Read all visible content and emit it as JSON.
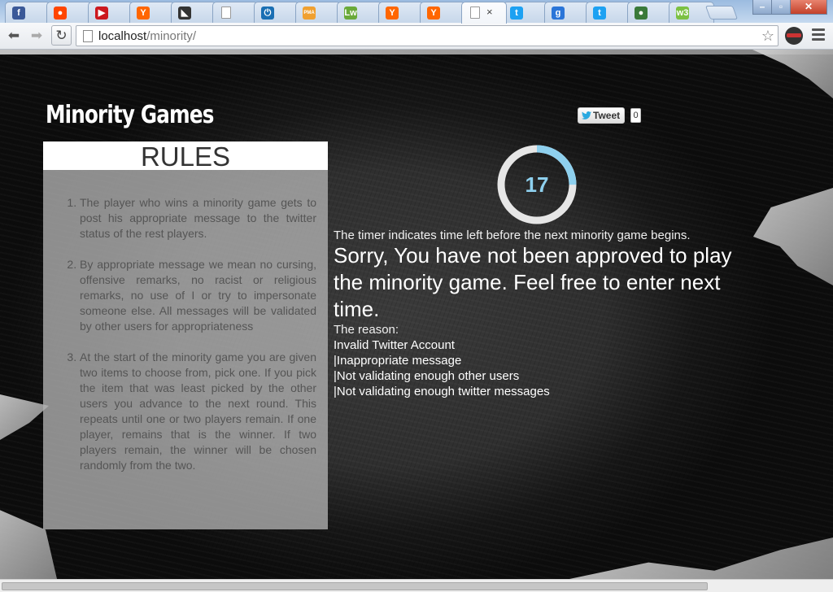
{
  "browser": {
    "tabs": [
      {
        "icon": "facebook-icon",
        "glyph": "f",
        "color": "#3b5998"
      },
      {
        "icon": "reddit-icon",
        "glyph": "●",
        "color": "#ff4500"
      },
      {
        "icon": "youtube-icon",
        "glyph": "▶",
        "color": "#cc181e"
      },
      {
        "icon": "hacker-news-icon",
        "glyph": "Y",
        "color": "#ff6600"
      },
      {
        "icon": "app-icon",
        "glyph": "◣",
        "color": "#333333"
      },
      {
        "icon": "blank-page-icon",
        "glyph": "",
        "color": "#ffffff"
      },
      {
        "icon": "power-icon",
        "glyph": "⏻",
        "color": "#1a6fb3"
      },
      {
        "icon": "phpmyadmin-icon",
        "glyph": "PMA",
        "color": "#f0a030"
      },
      {
        "icon": "lw-icon",
        "glyph": "Lw",
        "color": "#6aaa3a"
      },
      {
        "icon": "hacker-news-icon",
        "glyph": "Y",
        "color": "#ff6600"
      },
      {
        "icon": "hacker-news-icon",
        "glyph": "Y",
        "color": "#ff6600"
      },
      {
        "icon": "blank-page-icon",
        "glyph": "",
        "color": "#ffffff",
        "active": true
      },
      {
        "icon": "twitter-icon",
        "glyph": "t",
        "color": "#1da1f2"
      },
      {
        "icon": "google-plus-icon",
        "glyph": "g",
        "color": "#2a75d8"
      },
      {
        "icon": "twitter-icon",
        "glyph": "t",
        "color": "#1da1f2"
      },
      {
        "icon": "green-circle-icon",
        "glyph": "●",
        "color": "#3a7a3a"
      },
      {
        "icon": "w3-icon",
        "glyph": "w3",
        "color": "#7cc142"
      }
    ],
    "close_glyph": "×",
    "url_host": "localhost",
    "url_path": "/minority/",
    "star_glyph": "☆"
  },
  "page": {
    "site_title": "Minority Games",
    "rules_heading": "RULES",
    "rules": [
      "The player who wins a minority game gets to post his appropriate message to the twitter status of the rest players.",
      "By appropriate message we mean no cursing, offensive remarks, no racist or religious remarks, no use of I or try to impersonate someone else. All messages will be validated by other users for appropriateness",
      "At the start of the minority game you are given two items to choose from, pick one. If you pick the item that was least picked by the other users you advance to the next round. This repeats until one or two players remain. If one player, remains that is the winner. If two players remain, the winner will be chosen randomly from the two."
    ],
    "tweet_label": "Tweet",
    "tweet_count": "0",
    "timer_value": "17",
    "timer_fraction_remaining": 0.25,
    "timer_note": "The timer indicates time left before the next minority game begins.",
    "sorry_message": "Sorry, You have not been approved to play the minority game. Feel free to enter next time.",
    "reason_title": "The reason:",
    "reasons": [
      "Invalid Twitter Account",
      "|Inappropriate message",
      "|Not validating enough other users",
      "|Not validating enough twitter messages"
    ]
  },
  "colors": {
    "accent": "#8ed0ee",
    "timer_track": "#e6e6e6"
  }
}
